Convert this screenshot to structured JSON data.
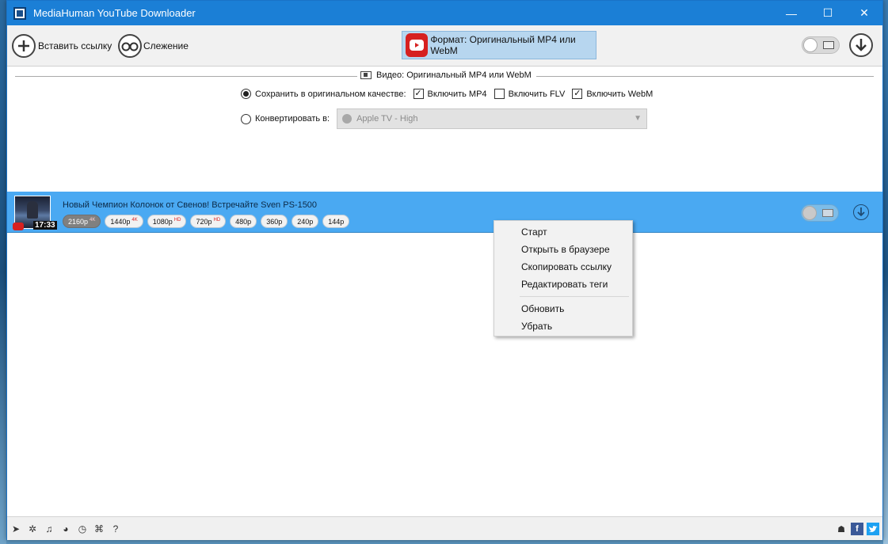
{
  "window": {
    "title": "MediaHuman YouTube Downloader",
    "controls": {
      "minimize": "—",
      "maximize": "☐",
      "close": "✕"
    }
  },
  "toolbar": {
    "paste_label": "Вставить ссылку",
    "tracking_label": "Слежение",
    "format_label": "Формат: Оригинальный MP4 или WebM"
  },
  "settings": {
    "section_title": "Видео: Оригинальный MP4 или WebM",
    "save_original_label": "Сохранить в оригинальном качестве:",
    "save_original_selected": true,
    "include_mp4_label": "Включить MP4",
    "include_mp4_checked": true,
    "include_flv_label": "Включить FLV",
    "include_flv_checked": false,
    "include_webm_label": "Включить WebM",
    "include_webm_checked": true,
    "convert_label": "Конвертировать в:",
    "convert_selected": false,
    "convert_value": "Apple TV - High"
  },
  "video": {
    "title": "Новый Чемпион Колонок от Свенов! Встречайте Sven PS-1500",
    "duration": "17:33",
    "qualities": [
      {
        "label": "2160p",
        "badge": "4K",
        "selected": true
      },
      {
        "label": "1440p",
        "badge": "4K",
        "selected": false
      },
      {
        "label": "1080p",
        "badge": "HD",
        "selected": false
      },
      {
        "label": "720p",
        "badge": "HD",
        "selected": false
      },
      {
        "label": "480p",
        "badge": "",
        "selected": false
      },
      {
        "label": "360p",
        "badge": "",
        "selected": false
      },
      {
        "label": "240p",
        "badge": "",
        "selected": false
      },
      {
        "label": "144p",
        "badge": "",
        "selected": false
      }
    ]
  },
  "context_menu": {
    "start": "Старт",
    "open_browser": "Открыть в браузере",
    "copy_link": "Скопировать ссылку",
    "edit_tags": "Редактировать теги",
    "refresh": "Обновить",
    "remove": "Убрать"
  },
  "statusbar": {
    "icons": [
      "send-icon",
      "settings-icon",
      "music-icon",
      "snail-icon",
      "clock-icon",
      "binoculars-icon",
      "help-icon"
    ],
    "social": [
      "robot-icon",
      "facebook-icon",
      "twitter-icon"
    ],
    "facebook_letter": "f"
  },
  "colors": {
    "titlebar": "#1b7fd6",
    "selected_row": "#4aa9f2",
    "format_button": "#b7d6ef",
    "youtube_red": "#d62020"
  }
}
